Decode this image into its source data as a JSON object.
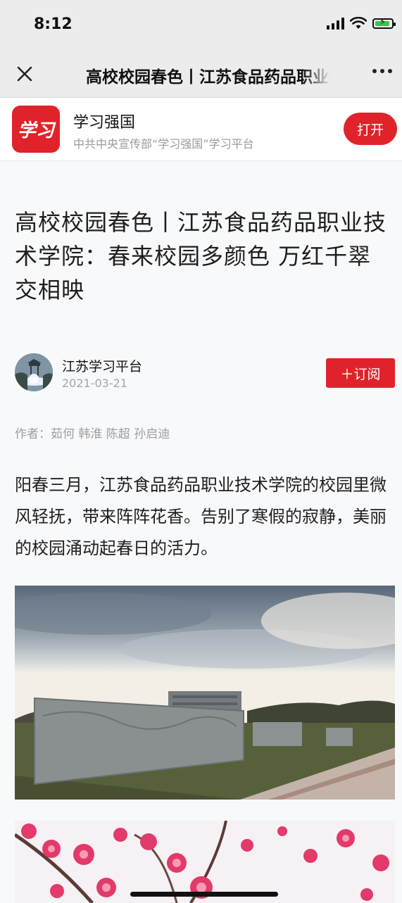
{
  "status_bar": {
    "time": "8:12"
  },
  "nav": {
    "title": "高校校园春色丨江苏食品药品职业技术学院：春来校园多颜色 万红千翠交相映"
  },
  "app_banner": {
    "logo_text": "学习",
    "name": "学习强国",
    "subtitle": "中共中央宣传部“学习强国”学习平台",
    "open_label": "打开"
  },
  "article": {
    "title": "高校校园春色丨江苏食品药品职业技术学院：春来校园多颜色 万红千翠交相映",
    "source_name": "江苏学习平台",
    "date": "2021-03-21",
    "subscribe_label": "＋订阅",
    "byline": "作者：茹何 韩淮 陈超 孙启迪",
    "paragraph": "阳春三月，江苏食品药品职业技术学院的校园里微风轻抚，带来阵阵花香。告别了寒假的寂静，美丽的校园涌动起春日的活力。"
  },
  "colors": {
    "accent": "#e0232a",
    "nav_bg": "#ececec",
    "content_bg": "#f8f9fb"
  }
}
